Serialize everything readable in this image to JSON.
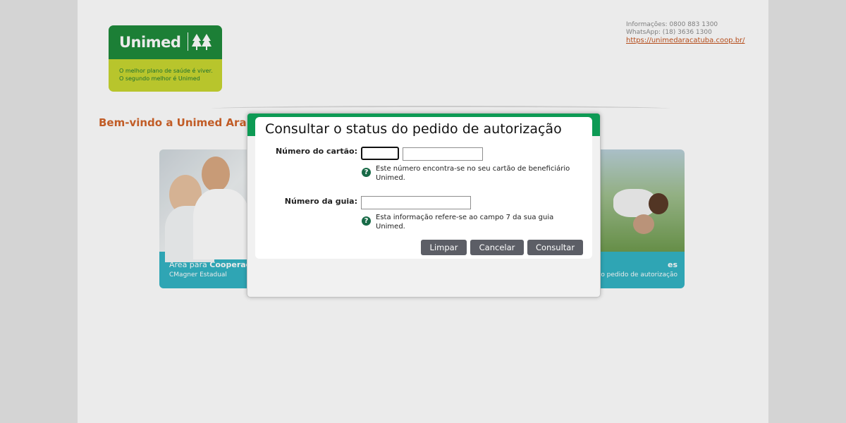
{
  "header": {
    "logo": {
      "word": "Unimed",
      "slogan_line1": "O melhor plano de saúde é viver.",
      "slogan_line2": "O segundo melhor é Unimed"
    },
    "contact": {
      "phone": "Informações: 0800 883 1300",
      "whatsapp": "WhatsApp: (18) 3636 1300",
      "url": "https://unimedaracatuba.coop.br/"
    }
  },
  "main": {
    "welcome": "Bem-vindo a Unimed Araçatu",
    "cards": [
      {
        "title_prefix": "Área para ",
        "title_bold": "Cooperado",
        "subtitle": "CMagner Estadual"
      },
      {
        "title_prefix": "",
        "title_bold": "es",
        "subtitle": "o pedido de autorização"
      }
    ]
  },
  "modal": {
    "title": "Consultar o status do pedido de autorização",
    "card_number": {
      "label": "Número do cartão:",
      "part1_value": "",
      "part2_value": "",
      "hint_line1": "Este número encontra-se no seu cartão de beneficiário",
      "hint_line2": "Unimed."
    },
    "guide_number": {
      "label": "Número da guia:",
      "value": "",
      "hint_line1": "Esta informação refere-se ao campo 7 da sua guia",
      "hint_line2": "Unimed."
    },
    "help_glyph": "?",
    "buttons": {
      "clear": "Limpar",
      "cancel": "Cancelar",
      "submit": "Consultar"
    }
  },
  "colors": {
    "brand_green": "#1f8a3b",
    "modal_green": "#0d9a54",
    "brand_lime": "#c8d630",
    "accent_orange": "#d2642a",
    "card_teal": "#33b3c4",
    "button_gray": "#5c5e66"
  }
}
